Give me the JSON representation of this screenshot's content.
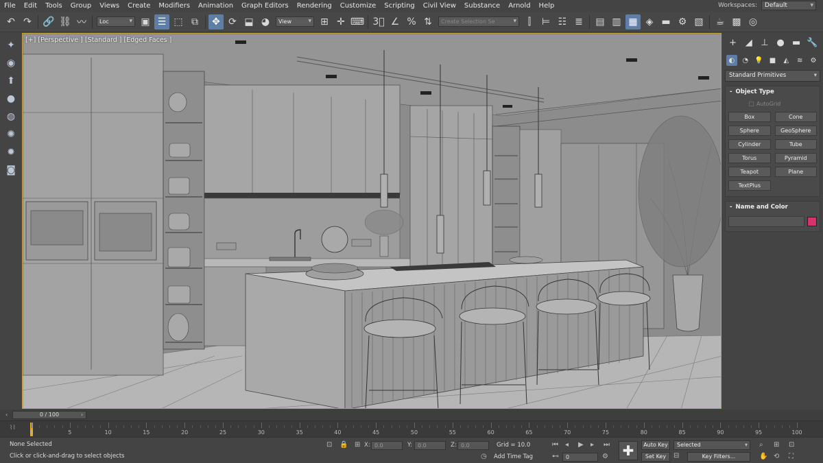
{
  "menu": [
    "File",
    "Edit",
    "Tools",
    "Group",
    "Views",
    "Create",
    "Modifiers",
    "Animation",
    "Graph Editors",
    "Rendering",
    "Customize",
    "Scripting",
    "Civil View",
    "Substance",
    "Arnold",
    "Help"
  ],
  "workspaces": {
    "label": "Workspaces:",
    "value": "Default"
  },
  "toolbar": {
    "layer_select": "Loc",
    "ref_coord": "View",
    "named_selection": "Create Selection Se"
  },
  "viewport": {
    "label": "[+] [Perspective ] [Standard ] [Edged Faces ]"
  },
  "command_panel": {
    "category": "Standard Primitives",
    "object_type_title": "Object Type",
    "autogrid": "AutoGrid",
    "primitives": [
      "Box",
      "Cone",
      "Sphere",
      "GeoSphere",
      "Cylinder",
      "Tube",
      "Torus",
      "Pyramid",
      "Teapot",
      "Plane",
      "TextPlus"
    ],
    "name_color_title": "Name and Color",
    "object_color": "#d4336e"
  },
  "time_slider": {
    "frame": "0 / 100"
  },
  "trackbar": {
    "ticks": [
      "0",
      "5",
      "10",
      "15",
      "20",
      "25",
      "30",
      "35",
      "40",
      "45",
      "50",
      "55",
      "60",
      "65",
      "70",
      "75",
      "80",
      "85",
      "90",
      "95",
      "100"
    ]
  },
  "status": {
    "selection": "None Selected",
    "prompt": "Click or click-and-drag to select objects",
    "x_label": "X:",
    "x_value": "0.0",
    "y_label": "Y:",
    "y_value": "0.0",
    "z_label": "Z:",
    "z_value": "0.0",
    "grid": "Grid = 10.0",
    "add_time_tag": "Add Time Tag",
    "auto_key": "Auto Key",
    "set_key": "Set Key",
    "key_mode": "Selected",
    "key_filters": "Key Filters...",
    "current_frame": "0"
  }
}
